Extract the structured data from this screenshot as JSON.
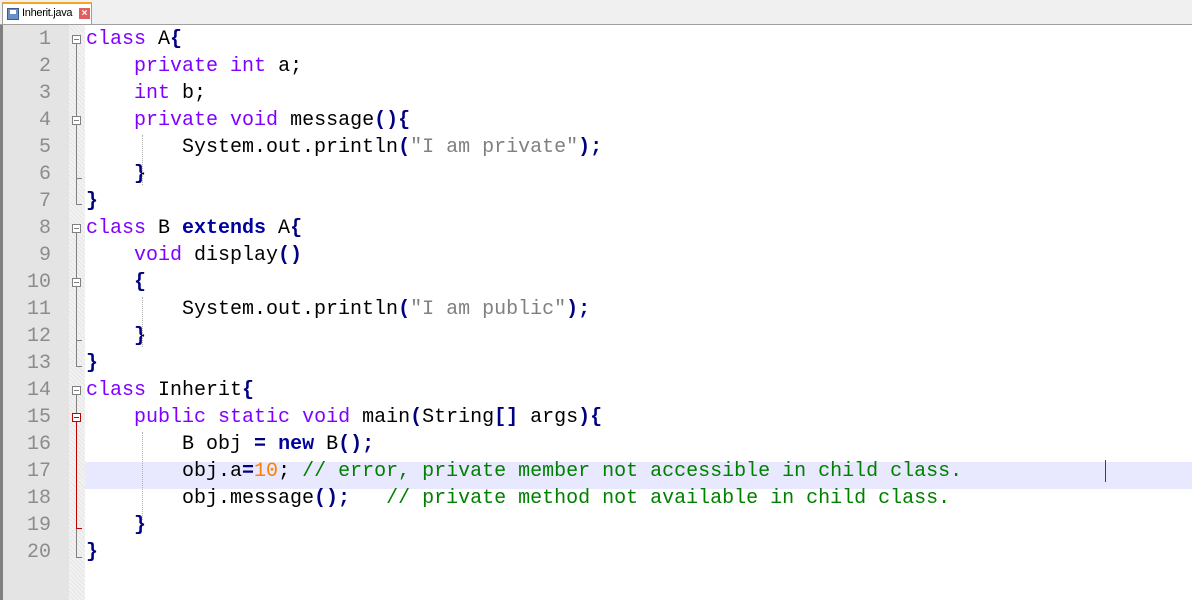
{
  "tab": {
    "filename": "Inherit.java",
    "save_icon": "floppy-disk-icon",
    "close_icon": "close-icon"
  },
  "editor": {
    "current_line": 17,
    "line_numbers": [
      "1",
      "2",
      "3",
      "4",
      "5",
      "6",
      "7",
      "8",
      "9",
      "10",
      "11",
      "12",
      "13",
      "14",
      "15",
      "16",
      "17",
      "18",
      "19",
      "20"
    ],
    "lines": [
      [
        {
          "t": "class",
          "c": "kw"
        },
        {
          "t": " A"
        },
        {
          "t": "{",
          "c": "op"
        }
      ],
      [
        {
          "t": "    "
        },
        {
          "t": "private",
          "c": "kw"
        },
        {
          "t": " "
        },
        {
          "t": "int",
          "c": "kw"
        },
        {
          "t": " a;"
        }
      ],
      [
        {
          "t": "    "
        },
        {
          "t": "int",
          "c": "kw"
        },
        {
          "t": " b;"
        }
      ],
      [
        {
          "t": "    "
        },
        {
          "t": "private",
          "c": "kw"
        },
        {
          "t": " "
        },
        {
          "t": "void",
          "c": "kw"
        },
        {
          "t": " message"
        },
        {
          "t": "(){",
          "c": "op"
        }
      ],
      [
        {
          "t": "        System.out.println"
        },
        {
          "t": "(",
          "c": "op"
        },
        {
          "t": "\"I am private\"",
          "c": "str"
        },
        {
          "t": ");",
          "c": "op"
        }
      ],
      [
        {
          "t": "    "
        },
        {
          "t": "}",
          "c": "op"
        }
      ],
      [
        {
          "t": "}",
          "c": "op"
        }
      ],
      [
        {
          "t": "class",
          "c": "kw"
        },
        {
          "t": " B "
        },
        {
          "t": "extends",
          "c": "kwb"
        },
        {
          "t": " A"
        },
        {
          "t": "{",
          "c": "op"
        }
      ],
      [
        {
          "t": "    "
        },
        {
          "t": "void",
          "c": "kw"
        },
        {
          "t": " display"
        },
        {
          "t": "()",
          "c": "op"
        }
      ],
      [
        {
          "t": "    "
        },
        {
          "t": "{",
          "c": "op"
        }
      ],
      [
        {
          "t": "        System.out.println"
        },
        {
          "t": "(",
          "c": "op"
        },
        {
          "t": "\"I am public\"",
          "c": "str"
        },
        {
          "t": ");",
          "c": "op"
        }
      ],
      [
        {
          "t": "    "
        },
        {
          "t": "}",
          "c": "op"
        }
      ],
      [
        {
          "t": "}",
          "c": "op"
        }
      ],
      [
        {
          "t": "class",
          "c": "kw"
        },
        {
          "t": " Inherit"
        },
        {
          "t": "{",
          "c": "op"
        }
      ],
      [
        {
          "t": "    "
        },
        {
          "t": "public",
          "c": "kw"
        },
        {
          "t": " "
        },
        {
          "t": "static",
          "c": "kw"
        },
        {
          "t": " "
        },
        {
          "t": "void",
          "c": "kw"
        },
        {
          "t": " main"
        },
        {
          "t": "(",
          "c": "op"
        },
        {
          "t": "String"
        },
        {
          "t": "[]",
          "c": "op"
        },
        {
          "t": " args"
        },
        {
          "t": "){",
          "c": "op"
        }
      ],
      [
        {
          "t": "        B obj "
        },
        {
          "t": "=",
          "c": "op"
        },
        {
          "t": " "
        },
        {
          "t": "new",
          "c": "kwb"
        },
        {
          "t": " B"
        },
        {
          "t": "();",
          "c": "op"
        }
      ],
      [
        {
          "t": "        obj.a"
        },
        {
          "t": "=",
          "c": "op"
        },
        {
          "t": "10",
          "c": "num"
        },
        {
          "t": "; "
        },
        {
          "t": "// error, private member not accessible in child class.",
          "c": "cmt"
        }
      ],
      [
        {
          "t": "        obj.message"
        },
        {
          "t": "();",
          "c": "op"
        },
        {
          "t": "   "
        },
        {
          "t": "// private method not available in child class.",
          "c": "cmt"
        }
      ],
      [
        {
          "t": "    "
        },
        {
          "t": "}",
          "c": "op"
        }
      ],
      [
        {
          "t": "}",
          "c": "op"
        }
      ]
    ]
  }
}
